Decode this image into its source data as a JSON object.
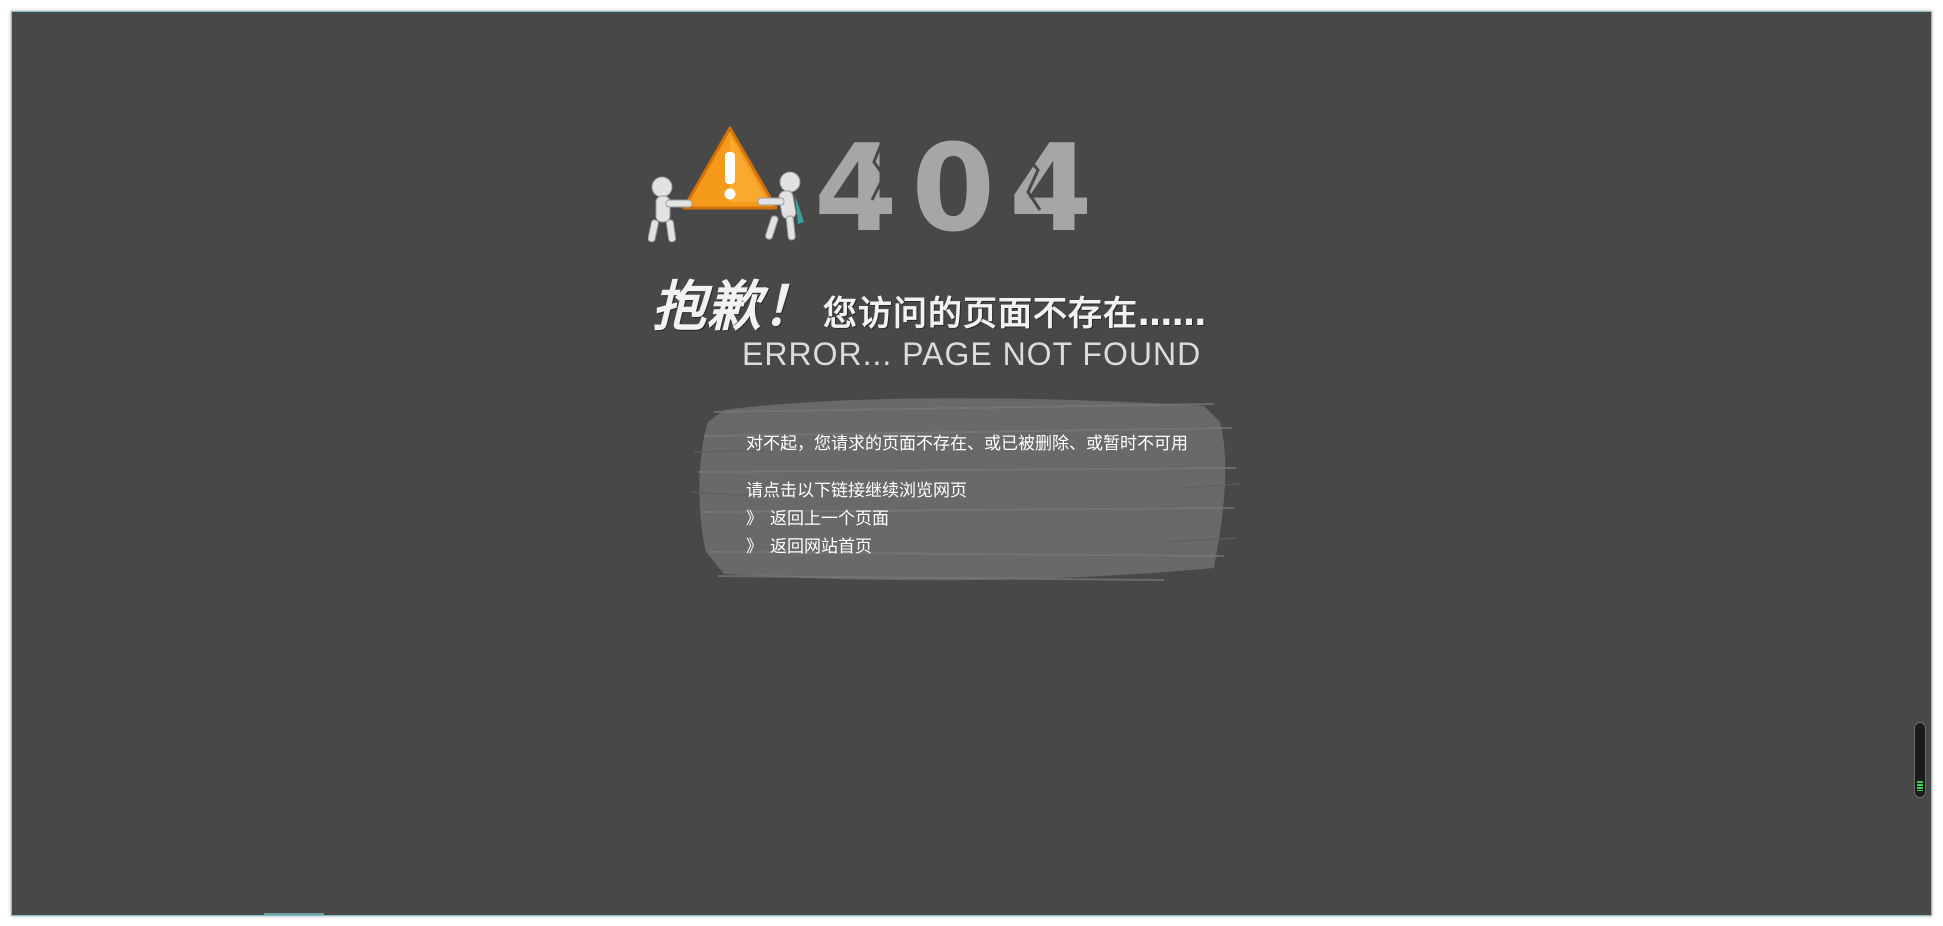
{
  "hero": {
    "code": "404",
    "title_big": "抱歉！",
    "title_small": "您访问的页面不存在",
    "title_dots": "……",
    "subtitle": "ERROR... PAGE NOT FOUND"
  },
  "message": {
    "line1": "对不起，您请求的页面不存在、或已被删除、或暂时不可用",
    "line2": "请点击以下链接继续浏览网页",
    "links": [
      {
        "arrow": "》",
        "label": "返回上一个页面"
      },
      {
        "arrow": "》",
        "label": "返回网站首页"
      }
    ]
  },
  "colors": {
    "background": "#484848",
    "frame_border": "#7fc4c4",
    "code_gray": "#a6a6a6",
    "warning_orange": "#f59a1b",
    "text": "#ffffff"
  }
}
